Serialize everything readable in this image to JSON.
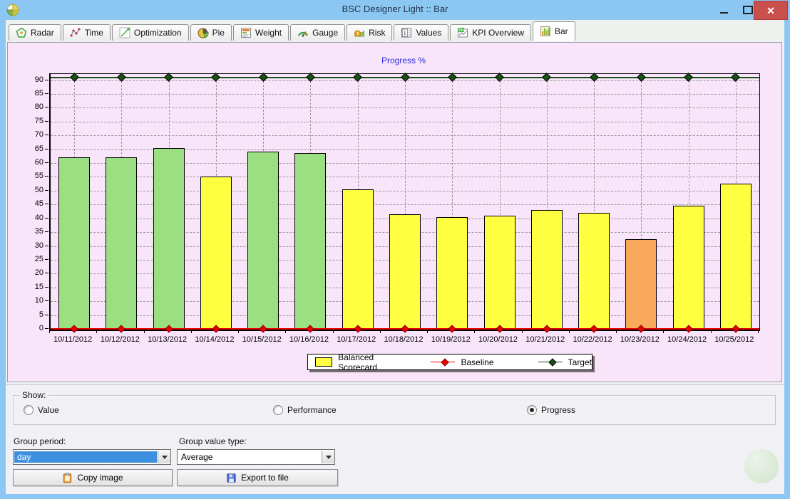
{
  "window": {
    "title": "BSC Designer Light :: Bar",
    "controls": {
      "minimize": "minimize",
      "maximize": "maximize",
      "close": "close"
    }
  },
  "tabs": {
    "items": [
      {
        "label": "Radar",
        "active": false
      },
      {
        "label": "Time",
        "active": false
      },
      {
        "label": "Optimization",
        "active": false
      },
      {
        "label": "Pie",
        "active": false
      },
      {
        "label": "Weight",
        "active": false
      },
      {
        "label": "Gauge",
        "active": false
      },
      {
        "label": "Risk",
        "active": false
      },
      {
        "label": "Values",
        "active": false
      },
      {
        "label": "KPI Overview",
        "active": false
      },
      {
        "label": "Bar",
        "active": true
      }
    ]
  },
  "chart_data": {
    "type": "bar",
    "title": "Progress %",
    "title_color": "#2a2ae0",
    "categories": [
      "10/11/2012",
      "10/12/2012",
      "10/13/2012",
      "10/14/2012",
      "10/15/2012",
      "10/16/2012",
      "10/17/2012",
      "10/18/2012",
      "10/19/2012",
      "10/20/2012",
      "10/21/2012",
      "10/22/2012",
      "10/23/2012",
      "10/24/2012",
      "10/25/2012"
    ],
    "series": [
      {
        "name": "Balanced Scorecard",
        "type": "bar",
        "values": [
          62,
          62,
          65.5,
          55,
          64,
          63.5,
          50.5,
          41.5,
          40.5,
          41,
          43,
          42,
          32.5,
          44.5,
          52.5
        ],
        "bar_colors": [
          "#9cdf83",
          "#9cdf83",
          "#9cdf83",
          "#ffff42",
          "#9cdf83",
          "#9cdf83",
          "#ffff42",
          "#ffff42",
          "#ffff42",
          "#ffff42",
          "#ffff42",
          "#ffff42",
          "#f8a95c",
          "#ffff42",
          "#ffff42"
        ]
      },
      {
        "name": "Baseline",
        "type": "line",
        "constant_value": 0,
        "color": "#e80000",
        "marker": "diamond"
      },
      {
        "name": "Target",
        "type": "line",
        "constant_value": 91,
        "color": "#175117",
        "marker": "diamond"
      }
    ],
    "ylim": [
      0,
      92.2
    ],
    "ytick_step": 5,
    "ytick_max": 90,
    "grid": "dashed",
    "plot_bg": "#f9e5f9",
    "legend_position": "bottom-center"
  },
  "legend": {
    "items": [
      {
        "label": "Balanced Scorecard",
        "swatch": "#ffff42"
      },
      {
        "label": "Baseline",
        "color": "#e80000"
      },
      {
        "label": "Target",
        "color": "#175117"
      }
    ]
  },
  "controls": {
    "show_group": {
      "label": "Show:",
      "options": [
        {
          "label": "Value",
          "selected": false
        },
        {
          "label": "Performance",
          "selected": false
        },
        {
          "label": "Progress",
          "selected": true
        }
      ]
    },
    "group_period": {
      "label": "Group period:",
      "value": "day",
      "focused": true
    },
    "group_value_type": {
      "label": "Group value type:",
      "value": "Average",
      "focused": false
    },
    "copy_image_label": "Copy image",
    "export_label": "Export to file"
  },
  "colors": {
    "titlebar": "#8cc7f4",
    "chart_bg": "#f9e5f9",
    "bar_green": "#9cdf83",
    "bar_yellow": "#ffff42",
    "bar_orange": "#f8a95c",
    "baseline_red": "#e80000",
    "target_green": "#175117",
    "selection_blue": "#3d8fe0",
    "close_button": "#c9504c"
  }
}
